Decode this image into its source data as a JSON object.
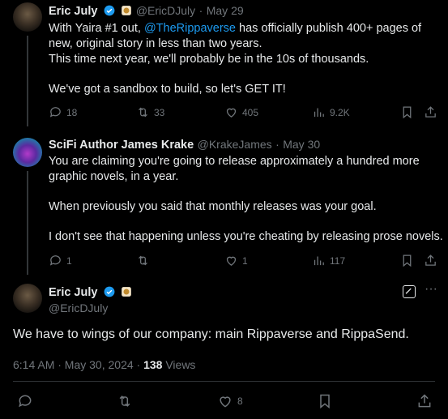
{
  "tweet1": {
    "name": "Eric July",
    "handle": "@EricDJuly",
    "dot": "·",
    "date": "May 29",
    "lines": {
      "l1_pre": "With Yaira #1 out, ",
      "l1_mention": "@TheRippaverse",
      "l1_post": " has officially publish 400+ pages of",
      "l2": "new, original story in less than two years.",
      "l3": "This time next year, we'll probably be in the 10s of thousands.",
      "l4": "We've got a sandbox to build, so let's GET IT!"
    },
    "actions": {
      "replies": "18",
      "reposts": "33",
      "likes": "405",
      "views": "9.2K"
    }
  },
  "tweet2": {
    "name": "SciFi Author James Krake",
    "handle": "@KrakeJames",
    "dot": "·",
    "date": "May 30",
    "lines": {
      "l1": "You are claiming you're going to release approximately a hundred more",
      "l2": "graphic novels, in a year.",
      "l3": "When previously you said that monthly releases was your goal.",
      "l4": "I don't see that happening unless you're cheating by releasing prose novels."
    },
    "actions": {
      "replies": "1",
      "likes": "1",
      "views": "117"
    }
  },
  "main": {
    "name": "Eric July",
    "handle": "@EricDJuly",
    "text": "We have to wings of our company: main Rippaverse and RippaSend.",
    "time": "6:14 AM · May 30, 2024 · ",
    "views_count": "138",
    "views_label": " Views",
    "actions": {
      "likes": "8"
    }
  },
  "colors": {
    "background": "#000000",
    "text": "#e7e9ea",
    "muted": "#71767b",
    "link": "#1d9bf0",
    "verified": "#1d9bf0"
  }
}
